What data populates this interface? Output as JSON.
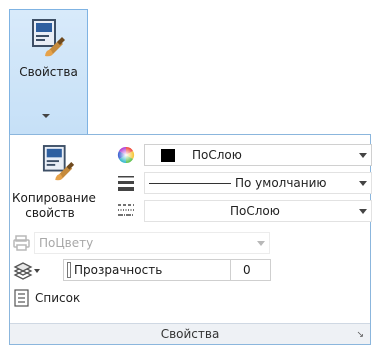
{
  "ribbon_button": {
    "label": "Свойства"
  },
  "panel": {
    "copy_properties_label_line1": "Копирование",
    "copy_properties_label_line2": "свойств",
    "color": {
      "value": "ПоСлою",
      "swatch": "#000000"
    },
    "lineweight": {
      "value": "По умолчанию"
    },
    "linetype": {
      "value": "ПоСлою"
    },
    "plotstyle": {
      "value": "ПоЦвету"
    },
    "transparency": {
      "label": "Прозрачность",
      "value": "0"
    },
    "list": {
      "label": "Список"
    },
    "footer": {
      "title": "Свойства",
      "launcher": "↘"
    }
  },
  "colors": {
    "highlight": "#c6e0f7",
    "border": "#7fb3e3"
  }
}
